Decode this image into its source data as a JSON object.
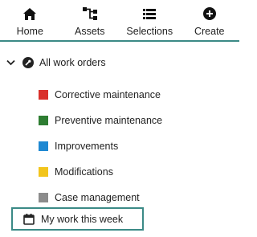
{
  "nav": {
    "items": [
      {
        "label": "Home",
        "icon": "home-icon"
      },
      {
        "label": "Assets",
        "icon": "hierarchy-icon"
      },
      {
        "label": "Selections",
        "icon": "list-icon"
      },
      {
        "label": "Create",
        "icon": "plus-circle-icon"
      }
    ]
  },
  "tree": {
    "root": {
      "label": "All work orders",
      "expanded": true,
      "icon": "wrench-icon"
    },
    "children": [
      {
        "label": "Corrective maintenance",
        "color": "#d9302b"
      },
      {
        "label": "Preventive maintenance",
        "color": "#2e7d32"
      },
      {
        "label": "Improvements",
        "color": "#1e88d2"
      },
      {
        "label": "Modifications",
        "color": "#f2c51c"
      },
      {
        "label": "Case management",
        "color": "#8c8c8c"
      }
    ]
  },
  "my_work": {
    "label": "My work this week",
    "icon": "calendar-icon"
  },
  "colors": {
    "accent": "#3b8a86"
  }
}
